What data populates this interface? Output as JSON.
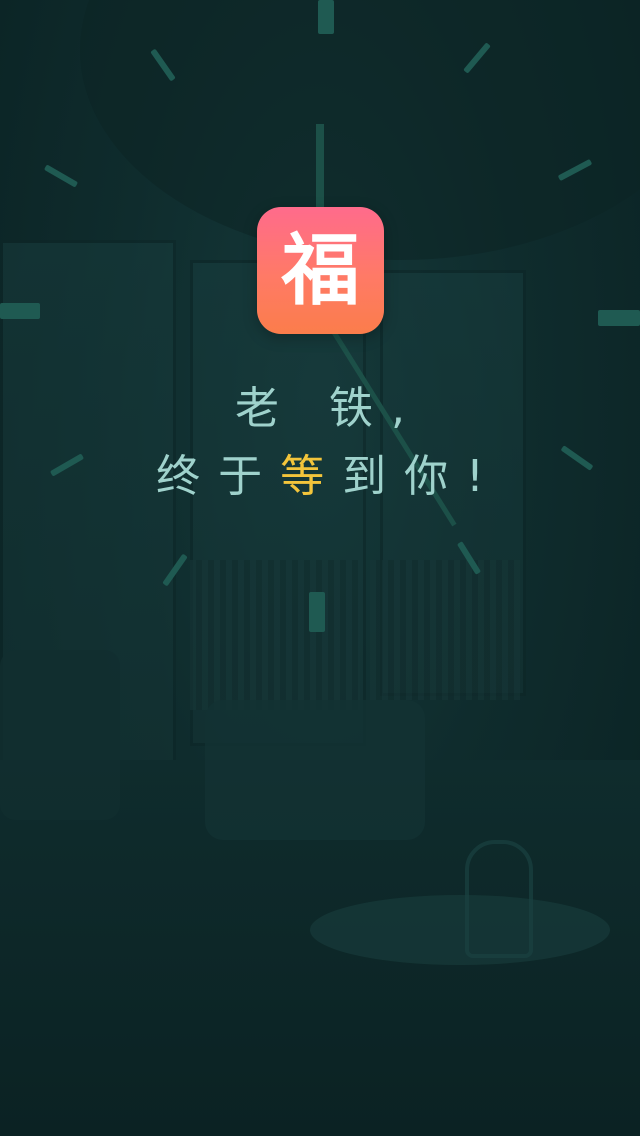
{
  "app_icon": {
    "glyph": "福",
    "colors": {
      "top": "#ff6b8c",
      "bottom": "#fb7d4b"
    }
  },
  "greeting": {
    "line1": "老 铁,",
    "line2_before": "终于",
    "line2_highlight": "等",
    "line2_after": "到你!"
  },
  "colors": {
    "background": "#0f2a2b",
    "text": "#9fd2cc",
    "highlight": "#f3c53b",
    "ticks": "#1f5a52"
  },
  "icons": [
    "fu-logo-icon",
    "clock-dial-icon"
  ]
}
